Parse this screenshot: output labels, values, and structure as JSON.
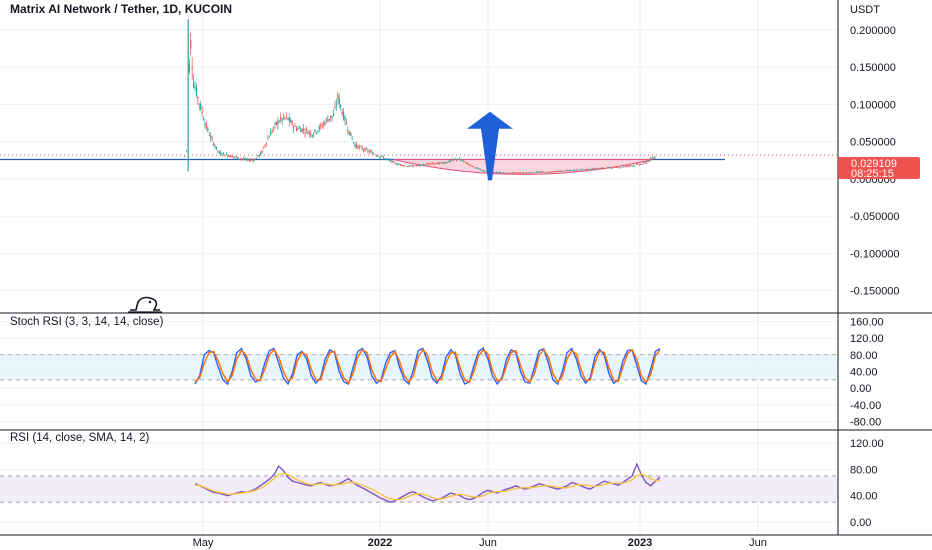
{
  "title": "Matrix AI Network / Tether, 1D, KUCOIN",
  "currency": "USDT",
  "price_tag": {
    "price": "0.029109",
    "countdown": "08:25:15",
    "color": "#ef5350"
  },
  "colors": {
    "up": "#26a69a",
    "down": "#ef5350",
    "support_line": "#1e5bb5",
    "cup_fill": "#f8c6d3",
    "cup_stroke": "#e84f79",
    "arrow": "#1f5fd8",
    "stoch_k": "#2962ff",
    "stoch_d": "#ff6d00",
    "rsi_line": "#7e57c2",
    "rsi_ma": "#f5c542",
    "stoch_band": "#e3f2fd",
    "rsi_band": "#ede7f6"
  },
  "chart_data": [
    {
      "type": "candlestick",
      "title": "Matrix AI Network / Tether, 1D, KUCOIN",
      "y_ticks": [
        "0.200000",
        "0.150000",
        "0.100000",
        "0.050000",
        "0.000000",
        "-0.050000",
        "-0.100000",
        "-0.150000"
      ],
      "y_tick_values": [
        0.2,
        0.15,
        0.1,
        0.05,
        0.0,
        -0.05,
        -0.1,
        -0.15
      ],
      "ylim": [
        -0.18,
        0.24
      ],
      "x_labels": [
        "May",
        "2022",
        "Jun",
        "2023",
        "Jun"
      ],
      "support_level": 0.026,
      "last_price": 0.029109,
      "price_path": [
        [
          0,
          0.03
        ],
        [
          3,
          0.05
        ],
        [
          4,
          0.15
        ],
        [
          5,
          0.19
        ],
        [
          8,
          0.13
        ],
        [
          12,
          0.11
        ],
        [
          16,
          0.09
        ],
        [
          20,
          0.07
        ],
        [
          26,
          0.05
        ],
        [
          32,
          0.035
        ],
        [
          40,
          0.032
        ],
        [
          50,
          0.028
        ],
        [
          60,
          0.025
        ],
        [
          66,
          0.026
        ],
        [
          72,
          0.035
        ],
        [
          80,
          0.06
        ],
        [
          88,
          0.078
        ],
        [
          96,
          0.082
        ],
        [
          104,
          0.068
        ],
        [
          112,
          0.066
        ],
        [
          120,
          0.06
        ],
        [
          128,
          0.07
        ],
        [
          134,
          0.08
        ],
        [
          140,
          0.085
        ],
        [
          144,
          0.11
        ],
        [
          148,
          0.09
        ],
        [
          154,
          0.065
        ],
        [
          160,
          0.045
        ],
        [
          168,
          0.04
        ],
        [
          176,
          0.035
        ],
        [
          184,
          0.03
        ],
        [
          192,
          0.025
        ],
        [
          200,
          0.02
        ],
        [
          210,
          0.017
        ],
        [
          220,
          0.018
        ],
        [
          230,
          0.02
        ],
        [
          240,
          0.021
        ],
        [
          248,
          0.023
        ],
        [
          256,
          0.027
        ],
        [
          264,
          0.022
        ],
        [
          272,
          0.016
        ],
        [
          280,
          0.011
        ],
        [
          290,
          0.009
        ],
        [
          300,
          0.008
        ],
        [
          310,
          0.008
        ],
        [
          320,
          0.008
        ],
        [
          330,
          0.009
        ],
        [
          340,
          0.009
        ],
        [
          350,
          0.01
        ],
        [
          360,
          0.011
        ],
        [
          370,
          0.012
        ],
        [
          380,
          0.013
        ],
        [
          390,
          0.014
        ],
        [
          400,
          0.015
        ],
        [
          410,
          0.016
        ],
        [
          420,
          0.018
        ],
        [
          430,
          0.02
        ],
        [
          434,
          0.022
        ],
        [
          438,
          0.026
        ],
        [
          442,
          0.029
        ]
      ],
      "cup": {
        "left_x": 196,
        "right_x": 440,
        "rim_y": 0.026,
        "bottom_y": 0.006
      },
      "arrow": {
        "x": 490,
        "top_y": 0.09,
        "bottom_y": -0.002
      }
    },
    {
      "type": "line",
      "title": "Stoch RSI (3, 3, 14, 14, close)",
      "y_ticks": [
        "160.00",
        "120.00",
        "80.00",
        "40.00",
        "0.00",
        "-40.00",
        "-80.00"
      ],
      "y_tick_values": [
        160,
        120,
        80,
        40,
        0,
        -40,
        -80
      ],
      "ylim": [
        -100,
        180
      ],
      "band": [
        20,
        80
      ],
      "series": [
        {
          "values": [
            10,
            30,
            80,
            90,
            85,
            50,
            20,
            10,
            40,
            85,
            95,
            70,
            30,
            15,
            20,
            60,
            90,
            95,
            60,
            25,
            10,
            35,
            80,
            88,
            70,
            30,
            12,
            25,
            70,
            92,
            85,
            40,
            15,
            10,
            50,
            88,
            95,
            75,
            30,
            12,
            20,
            60,
            85,
            90,
            50,
            20,
            10,
            45,
            90,
            95,
            65,
            25,
            12,
            30,
            75,
            92,
            80,
            35,
            10,
            15,
            55,
            88,
            96,
            70,
            28,
            10,
            25,
            70,
            92,
            86,
            40,
            15,
            12,
            50,
            90,
            94,
            60,
            20,
            10,
            40,
            85,
            95,
            70,
            30,
            12,
            25,
            75,
            93,
            80,
            35,
            12,
            20,
            65,
            90,
            92,
            55,
            18,
            10,
            45,
            88,
            95
          ]
        },
        {
          "values": [
            15,
            25,
            60,
            85,
            88,
            65,
            35,
            15,
            30,
            70,
            90,
            80,
            45,
            22,
            18,
            45,
            80,
            92,
            75,
            40,
            18,
            25,
            65,
            85,
            80,
            45,
            20,
            20,
            55,
            85,
            88,
            55,
            25,
            12,
            35,
            75,
            92,
            85,
            45,
            20,
            16,
            45,
            75,
            88,
            65,
            30,
            15,
            30,
            75,
            92,
            80,
            40,
            18,
            22,
            60,
            85,
            86,
            50,
            20,
            14,
            40,
            78,
            92,
            82,
            42,
            18,
            20,
            55,
            85,
            90,
            55,
            25,
            14,
            35,
            78,
            92,
            75,
            35,
            15,
            28,
            70,
            90,
            82,
            45,
            18,
            20,
            60,
            88,
            86,
            50,
            20,
            16,
            50,
            82,
            92,
            70,
            30,
            14,
            32,
            78,
            92
          ]
        }
      ]
    },
    {
      "type": "line",
      "title": "RSI (14, close, SMA, 14, 2)",
      "y_ticks": [
        "120.00",
        "80.00",
        "40.00",
        "0.00"
      ],
      "y_tick_values": [
        120,
        80,
        40,
        0
      ],
      "ylim": [
        -20,
        140
      ],
      "band": [
        30,
        70
      ],
      "series": [
        {
          "values": [
            58,
            55,
            52,
            48,
            45,
            44,
            42,
            40,
            42,
            44,
            46,
            45,
            47,
            50,
            55,
            60,
            65,
            72,
            85,
            78,
            68,
            62,
            60,
            58,
            56,
            55,
            58,
            60,
            57,
            55,
            56,
            58,
            62,
            66,
            60,
            55,
            52,
            48,
            44,
            40,
            36,
            33,
            30,
            32,
            36,
            40,
            44,
            46,
            42,
            38,
            35,
            32,
            34,
            36,
            40,
            44,
            42,
            40,
            36,
            34,
            36,
            40,
            45,
            48,
            46,
            44,
            47,
            50,
            52,
            55,
            52,
            50,
            52,
            55,
            58,
            56,
            54,
            52,
            50,
            52,
            55,
            60,
            58,
            55,
            52,
            50,
            54,
            58,
            62,
            60,
            58,
            56,
            60,
            65,
            70,
            88,
            72,
            60,
            55,
            62,
            68
          ]
        },
        {
          "values": [
            56,
            55,
            53,
            50,
            47,
            45,
            44,
            42,
            42,
            43,
            44,
            45,
            46,
            48,
            51,
            55,
            60,
            66,
            72,
            74,
            72,
            68,
            64,
            61,
            58,
            57,
            57,
            58,
            58,
            57,
            56,
            57,
            58,
            60,
            60,
            58,
            56,
            53,
            50,
            46,
            42,
            38,
            35,
            34,
            34,
            36,
            39,
            42,
            43,
            42,
            40,
            37,
            35,
            35,
            37,
            39,
            41,
            42,
            41,
            39,
            38,
            38,
            40,
            43,
            45,
            46,
            46,
            47,
            49,
            51,
            52,
            52,
            52,
            53,
            54,
            55,
            55,
            54,
            53,
            52,
            52,
            54,
            56,
            57,
            56,
            55,
            54,
            55,
            57,
            59,
            59,
            59,
            59,
            61,
            64,
            70,
            73,
            70,
            66,
            63,
            63
          ]
        }
      ]
    }
  ]
}
